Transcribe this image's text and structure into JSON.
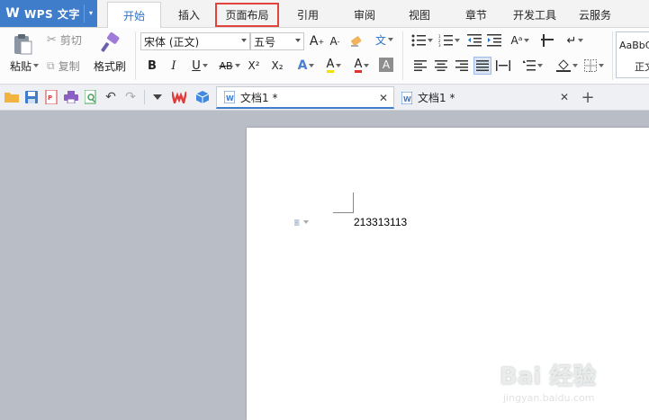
{
  "app": {
    "title": "WPS 文字"
  },
  "menu": {
    "tabs": [
      {
        "label": "开始",
        "active": true
      },
      {
        "label": "插入"
      },
      {
        "label": "页面布局",
        "highlighted": true
      },
      {
        "label": "引用"
      },
      {
        "label": "审阅"
      },
      {
        "label": "视图"
      },
      {
        "label": "章节"
      },
      {
        "label": "开发工具"
      },
      {
        "label": "云服务"
      }
    ]
  },
  "ribbon": {
    "paste_label": "粘贴",
    "cut_label": "剪切",
    "copy_label": "复制",
    "format_painter_label": "格式刷",
    "font_name": "宋体 (正文)",
    "font_size": "五号",
    "style_preview": "AaBbC",
    "style_name": "正文",
    "wen_glyph": "文",
    "bold": "B",
    "italic": "I",
    "underline": "U",
    "strike": "AB",
    "superscript": "X²",
    "subscript": "X₂",
    "text_effect": "A",
    "highlight": "A",
    "font_color": "A",
    "char_shading": "A",
    "grow_font": "A",
    "shrink_font": "A"
  },
  "doc_tabs": [
    {
      "label": "文档1 *",
      "active": true
    },
    {
      "label": "文档1 *",
      "active": false
    }
  ],
  "document": {
    "text": "213313113"
  },
  "watermark": {
    "main": "Bai 经验",
    "sub": "jingyan.baidu.com"
  },
  "colors": {
    "accent": "#3f7dcb",
    "highlight_box": "#e2443d",
    "workspace": "#b9bdc6"
  }
}
